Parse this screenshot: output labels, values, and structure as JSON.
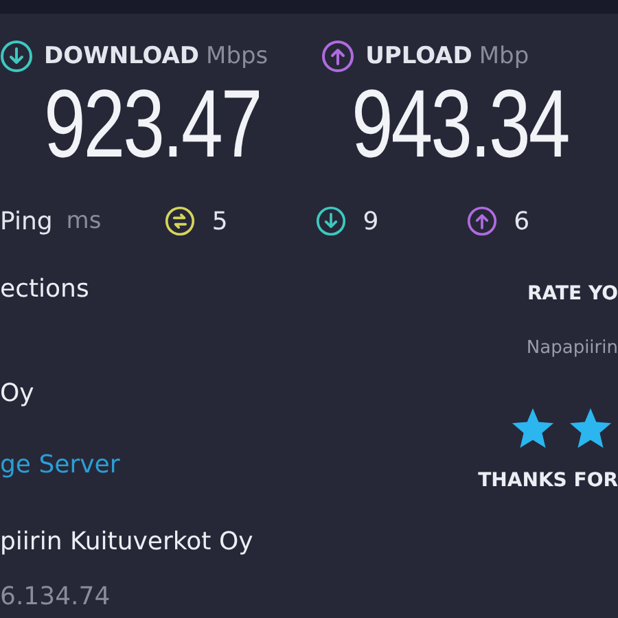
{
  "download": {
    "label": "DOWNLOAD",
    "unit": "Mbps",
    "value": "923.47"
  },
  "upload": {
    "label": "UPLOAD",
    "unit": "Mbp",
    "value": "943.34"
  },
  "ping": {
    "label": "Ping",
    "unit": "ms",
    "stats": [
      {
        "kind": "idle",
        "value": "5"
      },
      {
        "kind": "download",
        "value": "9"
      },
      {
        "kind": "upload",
        "value": "6"
      }
    ]
  },
  "details": [
    {
      "kind": "heading",
      "text": "ections"
    },
    {
      "kind": "value",
      "text": "Oy"
    },
    {
      "kind": "link",
      "text": "ge Server"
    },
    {
      "kind": "value",
      "text": "piirin Kuituverkot Oy"
    },
    {
      "kind": "muted",
      "text": "6.134.74"
    }
  ],
  "rating": {
    "title": "RATE YO",
    "provider": "Napapiirin",
    "thanks": "THANKS FOR"
  }
}
